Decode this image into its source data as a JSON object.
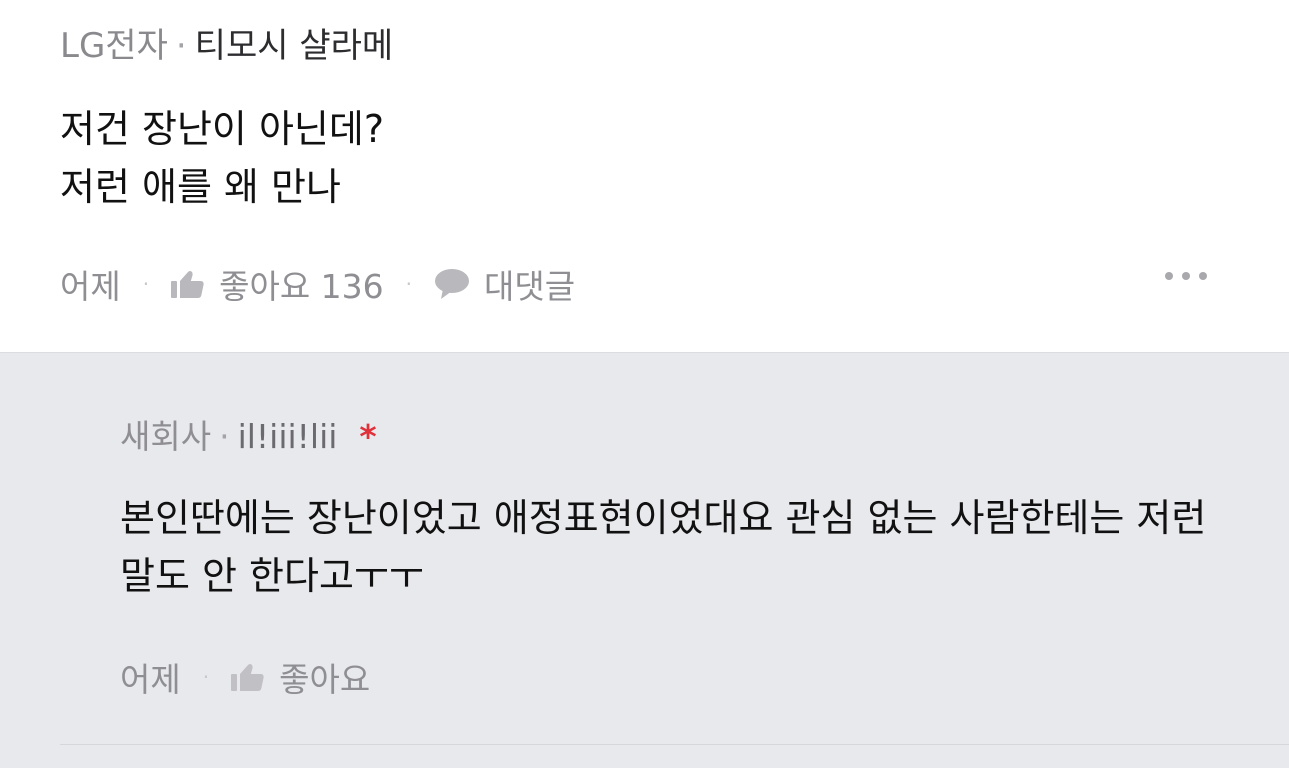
{
  "main_comment": {
    "company": "LG전자",
    "separator": "·",
    "author": "티모시 샬라메",
    "body": "저건 장난이 아닌데?\n저런 애를 왜 만나",
    "time": "어제",
    "dot": "·",
    "like_label": "좋아요 136",
    "reply_label": "대댓글"
  },
  "reply": {
    "company": "새회사",
    "separator": "·",
    "author": "il!iii!lii",
    "author_badge": "*",
    "body": "본인딴에는 장난이었고 애정표현이었대요 관심 없는 사람한테는 저런 말도 안 한다고ㅜㅜ",
    "time": "어제",
    "dot": "·",
    "like_label": "좋아요"
  },
  "icons": {
    "like": "thumbs-up-icon",
    "reply": "speech-bubble-icon",
    "more": "more-horizontal-icon"
  },
  "colors": {
    "reply_background": "#e8e9ed",
    "badge": "#e0303a",
    "muted_text": "#8e8e93"
  }
}
